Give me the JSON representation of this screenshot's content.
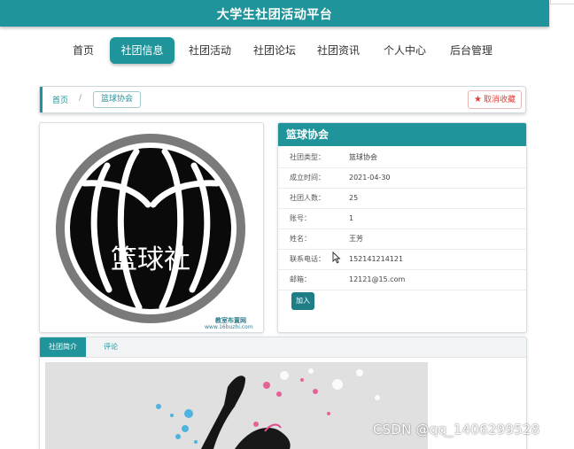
{
  "header": {
    "title": "大学生社团活动平台"
  },
  "nav": {
    "items": [
      {
        "label": "首页"
      },
      {
        "label": "社团信息"
      },
      {
        "label": "社团活动"
      },
      {
        "label": "社团论坛"
      },
      {
        "label": "社团资讯"
      },
      {
        "label": "个人中心"
      },
      {
        "label": "后台管理"
      }
    ],
    "active": "社团信息"
  },
  "breadcrumb": {
    "home": "首页",
    "separator": "/",
    "current": "篮球协会"
  },
  "favorite_button": {
    "label": "取消收藏",
    "icon": "star-icon"
  },
  "club_image": {
    "logo_text": "篮球社",
    "watermark_line1": "教室布置网",
    "watermark_line2": "www.16buzhi.com"
  },
  "club_info": {
    "name": "篮球协会",
    "fields": [
      {
        "label": "社团类型：",
        "value": "篮球协会"
      },
      {
        "label": "成立时间：",
        "value": "2021-04-30"
      },
      {
        "label": "社团人数：",
        "value": "25"
      },
      {
        "label": "账号：",
        "value": "1"
      },
      {
        "label": "姓名：",
        "value": "王芳"
      },
      {
        "label": "联系电话：",
        "value": "152141214121"
      },
      {
        "label": "邮箱：",
        "value": "12121@15.com"
      }
    ],
    "join_label": "加入"
  },
  "tabs": [
    {
      "label": "社团简介"
    },
    {
      "label": "评论"
    }
  ],
  "watermark": "CSDN @qq_1406299528",
  "colors": {
    "primary": "#1f949a",
    "favorite": "#e2403a",
    "join_button": "#1f7e85"
  }
}
